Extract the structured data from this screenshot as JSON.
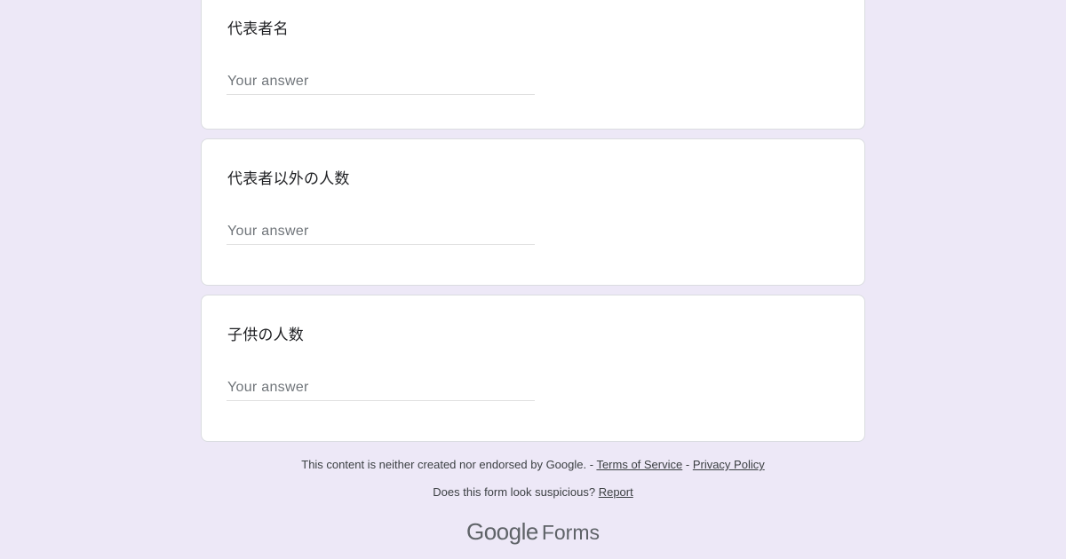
{
  "questions": [
    {
      "title": "代表者名",
      "placeholder": "Your answer"
    },
    {
      "title": "代表者以外の人数",
      "placeholder": "Your answer"
    },
    {
      "title": "子供の人数",
      "placeholder": "Your answer"
    }
  ],
  "footer": {
    "disclaimer": "This content is neither created nor endorsed by Google.",
    "sep1": " - ",
    "terms": "Terms of Service",
    "sep2": " - ",
    "privacy": "Privacy Policy",
    "suspicious": "Does this form look suspicious?",
    "report": "Report"
  },
  "brand": {
    "google": "Google",
    "forms": "Forms"
  },
  "colors": {
    "background": "#ede8f7",
    "card": "#ffffff",
    "text": "#202124",
    "muted": "#5f6368"
  }
}
